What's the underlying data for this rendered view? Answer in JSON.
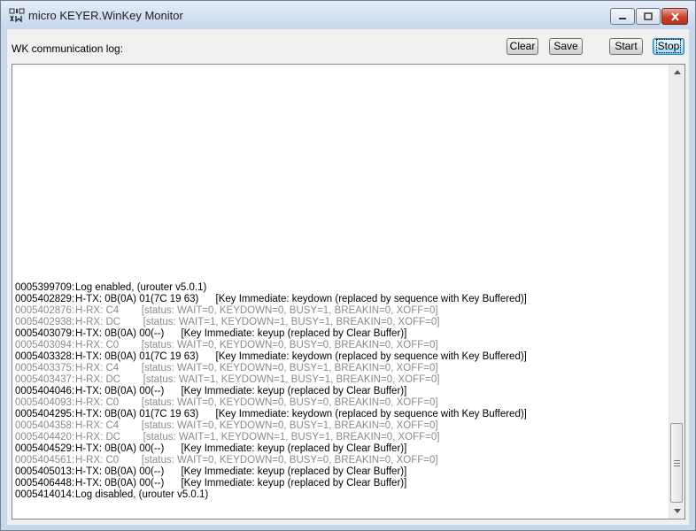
{
  "window": {
    "title": "micro KEYER.WinKey Monitor",
    "caption_buttons": {
      "minimize": "minimize-icon",
      "maximize": "maximize-icon",
      "close": "close-icon"
    }
  },
  "toolbar": {
    "log_label": "WK communication log:",
    "clear_label": "Clear",
    "save_label": "Save",
    "start_label": "Start",
    "stop_label": "Stop"
  },
  "log": [
    {
      "time": "0005399709:",
      "text": "Log enabled, (urouter v5.0.1)",
      "muted": false
    },
    {
      "time": "0005402829:",
      "text": "H-TX: 0B(0A) 01(7C 19 63)      [Key Immediate: keydown (replaced by sequence with Key Buffered)]",
      "muted": false
    },
    {
      "time": "0005402876:",
      "text": "H-RX: C4        [status: WAIT=0, KEYDOWN=0, BUSY=1, BREAKIN=0, XOFF=0]",
      "muted": true
    },
    {
      "time": "0005402938:",
      "text": "H-RX: DC        [status: WAIT=1, KEYDOWN=1, BUSY=1, BREAKIN=0, XOFF=0]",
      "muted": true
    },
    {
      "time": "0005403079:",
      "text": "H-TX: 0B(0A) 00(--)      [Key Immediate: keyup (replaced by Clear Buffer)]",
      "muted": false
    },
    {
      "time": "0005403094:",
      "text": "H-RX: C0        [status: WAIT=0, KEYDOWN=0, BUSY=0, BREAKIN=0, XOFF=0]",
      "muted": true
    },
    {
      "time": "0005403328:",
      "text": "H-TX: 0B(0A) 01(7C 19 63)      [Key Immediate: keydown (replaced by sequence with Key Buffered)]",
      "muted": false
    },
    {
      "time": "0005403375:",
      "text": "H-RX: C4        [status: WAIT=0, KEYDOWN=0, BUSY=1, BREAKIN=0, XOFF=0]",
      "muted": true
    },
    {
      "time": "0005403437:",
      "text": "H-RX: DC        [status: WAIT=1, KEYDOWN=1, BUSY=1, BREAKIN=0, XOFF=0]",
      "muted": true
    },
    {
      "time": "0005404046:",
      "text": "H-TX: 0B(0A) 00(--)      [Key Immediate: keyup (replaced by Clear Buffer)]",
      "muted": false
    },
    {
      "time": "0005404093:",
      "text": "H-RX: C0        [status: WAIT=0, KEYDOWN=0, BUSY=0, BREAKIN=0, XOFF=0]",
      "muted": true
    },
    {
      "time": "0005404295:",
      "text": "H-TX: 0B(0A) 01(7C 19 63)      [Key Immediate: keydown (replaced by sequence with Key Buffered)]",
      "muted": false
    },
    {
      "time": "0005404358:",
      "text": "H-RX: C4        [status: WAIT=0, KEYDOWN=0, BUSY=1, BREAKIN=0, XOFF=0]",
      "muted": true
    },
    {
      "time": "0005404420:",
      "text": "H-RX: DC        [status: WAIT=1, KEYDOWN=1, BUSY=1, BREAKIN=0, XOFF=0]",
      "muted": true
    },
    {
      "time": "0005404529:",
      "text": "H-TX: 0B(0A) 00(--)      [Key Immediate: keyup (replaced by Clear Buffer)]",
      "muted": false
    },
    {
      "time": "0005404561:",
      "text": "H-RX: C0        [status: WAIT=0, KEYDOWN=0, BUSY=0, BREAKIN=0, XOFF=0]",
      "muted": true
    },
    {
      "time": "0005405013:",
      "text": "H-TX: 0B(0A) 00(--)      [Key Immediate: keyup (replaced by Clear Buffer)]",
      "muted": false
    },
    {
      "time": "0005406448:",
      "text": "H-TX: 0B(0A) 00(--)      [Key Immediate: keyup (replaced by Clear Buffer)]",
      "muted": false
    },
    {
      "time": "0005414014:",
      "text": "Log disabled, (urouter v5.0.1)",
      "muted": false
    }
  ],
  "scrollbar": {
    "up": "scroll-up-arrow-icon",
    "down": "scroll-down-arrow-icon",
    "grip": "scroll-grip-icon"
  }
}
